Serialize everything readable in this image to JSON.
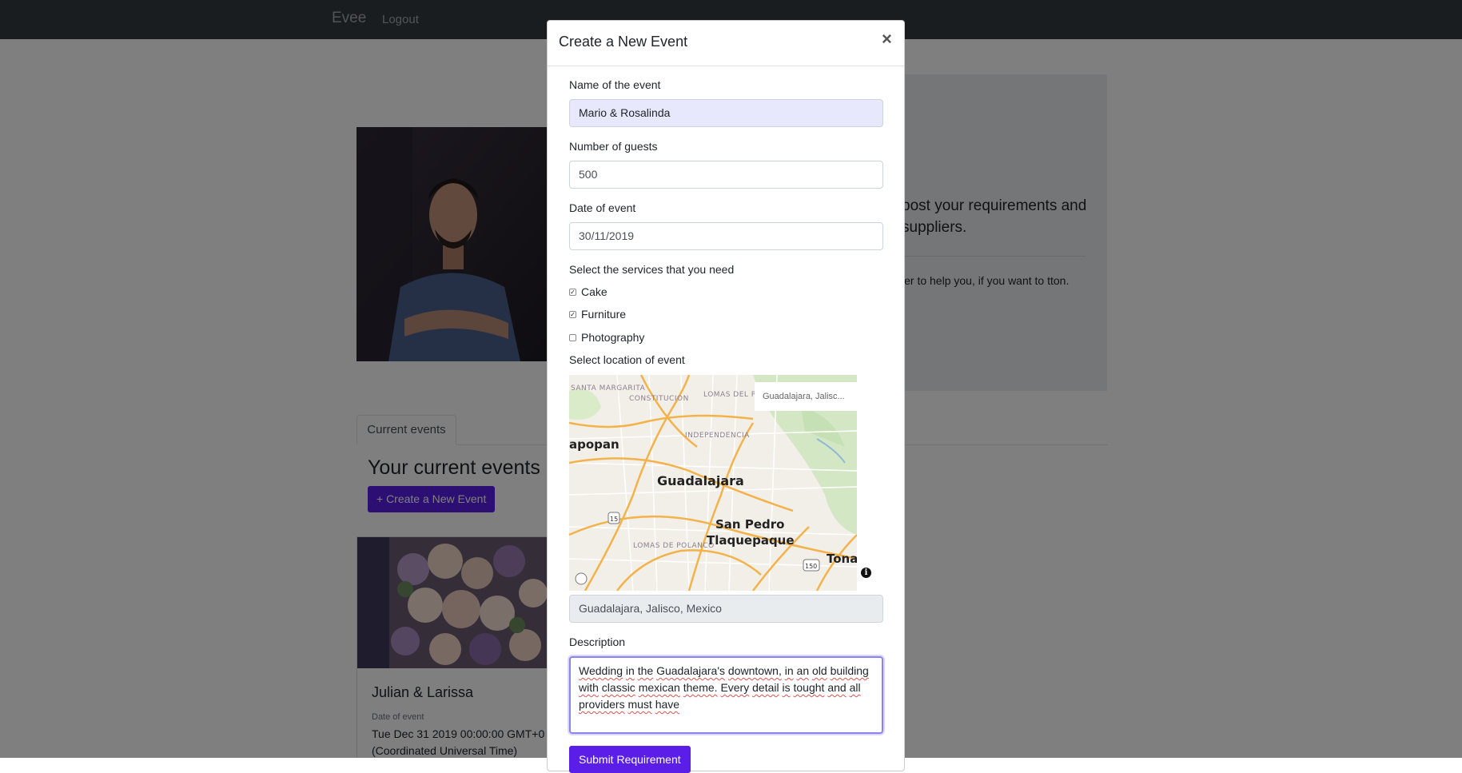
{
  "navbar": {
    "brand": "Evee",
    "logout": "Logout"
  },
  "jumbotron": {
    "lead": "post your requirements and suppliers.",
    "text": "ler to help you, if you want to tton."
  },
  "tabs": {
    "current": "Current events"
  },
  "events": {
    "title": "Your current events",
    "create_button": "+ Create a New Event",
    "card": {
      "title": "Julian & Larissa",
      "date_label": "Date of event",
      "date_value": "Tue Dec 31 2019 00:00:00 GMT+0 (Coordinated Universal Time)"
    }
  },
  "modal": {
    "title": "Create a New Event",
    "close": "×",
    "name_label": "Name of the event",
    "name_value": "Mario & Rosalinda",
    "guests_label": "Number of guests",
    "guests_value": "500",
    "date_label": "Date of event",
    "date_value": "30/11/2019",
    "services_label": "Select the services that you need",
    "services": [
      {
        "label": "Cake",
        "checked": true
      },
      {
        "label": "Furniture",
        "checked": true
      },
      {
        "label": "Photography",
        "checked": false
      }
    ],
    "location_label": "Select location of event",
    "map": {
      "search_value": "Guadalajara, Jalisc...",
      "search_close": "✕",
      "info_icon": "i",
      "labels": {
        "santa_margarita": "SANTA MARGARITA",
        "constitucion": "CONSTITUCION",
        "lomas_paraiso": "LOMAS DEL PARAISO",
        "zapopan": "apopan",
        "independencia": "INDEPENDENCIA",
        "guadalajara": "Guadalajara",
        "lomas_polanco": "LOMAS DE POLANCO",
        "san_pedro": "San Pedro",
        "tlaquepaque": "Tlaquepaque",
        "tona": "Tona",
        "shield_15": "15",
        "shield_150": "150"
      }
    },
    "location_value": "Guadalajara, Jalisco, Mexico",
    "description_label": "Description",
    "description_words": [
      "Wedding",
      "in",
      "the",
      "Guadalajara's",
      "downtown,",
      "in",
      "an",
      "old",
      "building",
      "with",
      "classic",
      "mexican",
      "theme.",
      "Every",
      "detail",
      "is",
      "tought",
      "and",
      "all",
      "providers",
      "must",
      "have"
    ],
    "submit": "Submit Requirement"
  },
  "colors": {
    "accent": "#5b1ee8",
    "navbar": "#343a40"
  }
}
